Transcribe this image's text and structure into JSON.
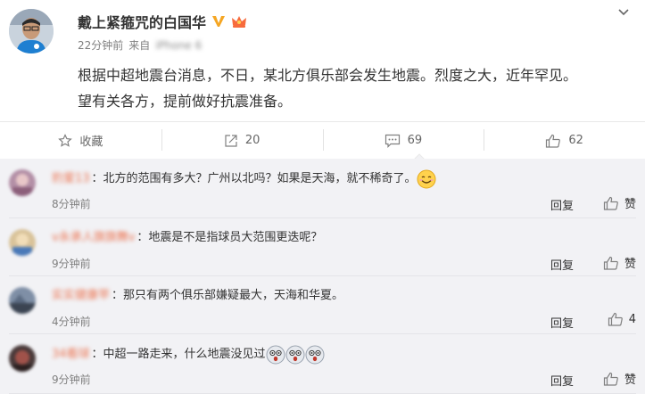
{
  "post": {
    "author": "戴上紧箍咒的白国华",
    "time": "22分钟前",
    "source_prefix": "来自",
    "source_device": "iPhone 6",
    "text_line1": "根据中超地震台消息，不日，某北方俱乐部会发生地震。烈度之大，近年罕见。",
    "text_line2": "望有关各方，提前做好抗震准备。"
  },
  "actions": {
    "favorite_label": "收藏",
    "repost_count": "20",
    "comment_count": "69",
    "like_count": "62"
  },
  "comments": [
    {
      "user": "豹爱13",
      "text": "：北方的范围有多大？广州以北吗？如果是天海，就不稀奇了。",
      "time": "8分钟前",
      "reply": "回复",
      "like": "赞"
    },
    {
      "user": "v永承人旗旗舞v",
      "text": "：地震是不是指球员大范围更迭呢？",
      "time": "9分钟前",
      "reply": "回复",
      "like": "赞"
    },
    {
      "user": "实实健康苹",
      "text": "：那只有两个俱乐部嫌疑最大，天海和华夏。",
      "time": "4分钟前",
      "reply": "回复",
      "like": "4"
    },
    {
      "user": "34看球",
      "text": "：中超一路走来，什么地震没见过",
      "time": "9分钟前",
      "reply": "回复",
      "like": "赞"
    }
  ],
  "colors": {
    "username": "#eb7350",
    "verified": "#f5a623",
    "comments_bg": "#f2f2f5"
  }
}
